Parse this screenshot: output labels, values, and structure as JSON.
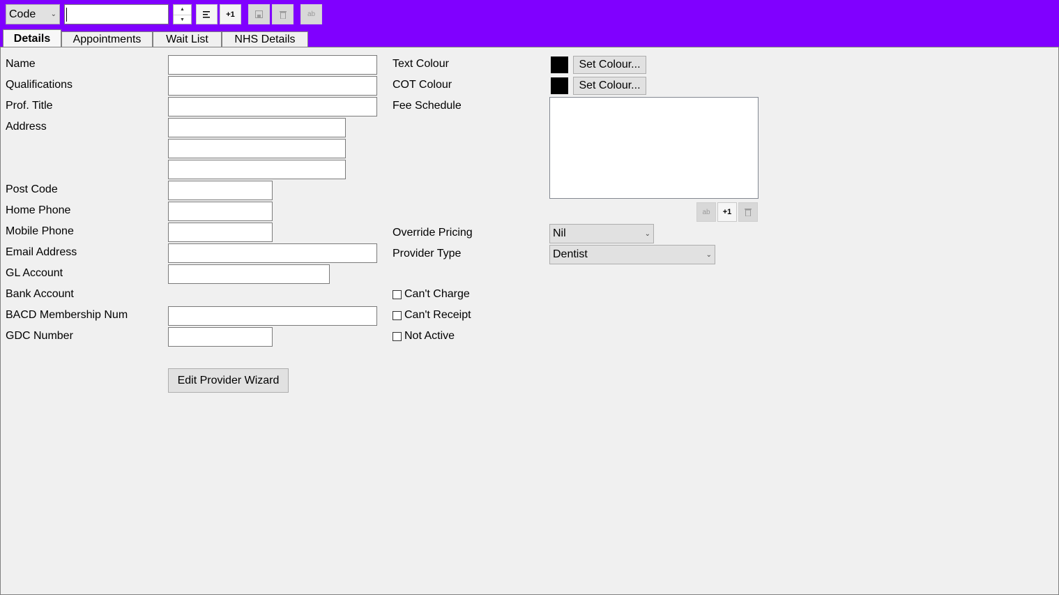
{
  "toolbar": {
    "code_select": "Code",
    "search_value": "",
    "btn_align_icon": "align-left-icon",
    "btn_plus_one": "+1",
    "btn_save_icon": "save-icon",
    "btn_delete_icon": "trash-icon",
    "btn_ab_icon": "rename-icon"
  },
  "tabs": [
    {
      "label": "Details",
      "active": true
    },
    {
      "label": "Appointments"
    },
    {
      "label": "Wait List"
    },
    {
      "label": "NHS Details"
    }
  ],
  "form": {
    "labels": {
      "name": "Name",
      "qualifications": "Qualifications",
      "prof_title": "Prof. Title",
      "address": "Address",
      "post_code": "Post Code",
      "home_phone": "Home Phone",
      "mobile_phone": "Mobile Phone",
      "email": "Email Address",
      "gl_account": "GL Account",
      "bank_account": "Bank Account",
      "bacd": "BACD Membership Num",
      "gdc": "GDC Number",
      "text_colour": "Text Colour",
      "cot_colour": "COT Colour",
      "fee_schedule": "Fee Schedule",
      "override_pricing": "Override Pricing",
      "provider_type": "Provider Type"
    },
    "set_colour_label": "Set Colour...",
    "override_pricing_value": "Nil",
    "provider_type_value": "Dentist",
    "fee_plus_one": "+1",
    "checkboxes": {
      "cant_charge": "Can't Charge",
      "cant_receipt": "Can't Receipt",
      "not_active": "Not Active"
    },
    "wizard_button": "Edit Provider Wizard",
    "colors": {
      "topbar": "#8000ff",
      "text_colour_swatch": "#000000",
      "cot_colour_swatch": "#000000"
    }
  }
}
